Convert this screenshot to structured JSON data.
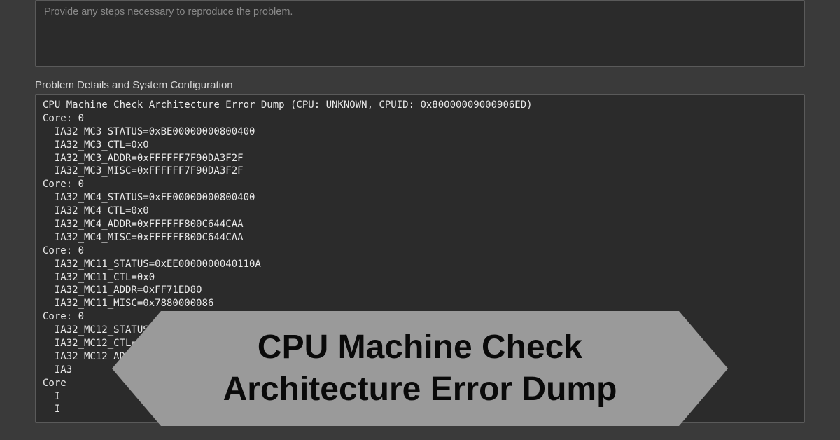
{
  "steps": {
    "placeholder": "Provide any steps necessary to reproduce the problem."
  },
  "section": {
    "label": "Problem Details and System Configuration"
  },
  "dump": {
    "text": "CPU Machine Check Architecture Error Dump (CPU: UNKNOWN, CPUID: 0x80000009000906ED)\nCore: 0\n  IA32_MC3_STATUS=0xBE00000000800400\n  IA32_MC3_CTL=0x0\n  IA32_MC3_ADDR=0xFFFFFF7F90DA3F2F\n  IA32_MC3_MISC=0xFFFFFF7F90DA3F2F\nCore: 0\n  IA32_MC4_STATUS=0xFE00000000800400\n  IA32_MC4_CTL=0x0\n  IA32_MC4_ADDR=0xFFFFFF800C644CAA\n  IA32_MC4_MISC=0xFFFFFF800C644CAA\nCore: 0\n  IA32_MC11_STATUS=0xEE0000000040110A\n  IA32_MC11_CTL=0x0\n  IA32_MC11_ADDR=0xFF71ED80\n  IA32_MC11_MISC=0x7880000086\nCore: 0\n  IA32_MC12_STATUS=0xEE0000000040110A\n  IA32_MC12_CTL=0x0\n  IA32_MC12_ADDR=0xFF71D400\n  IA3\nCore\n  I\n  I"
  },
  "banner": {
    "text": "CPU Machine Check Architecture Error Dump"
  }
}
